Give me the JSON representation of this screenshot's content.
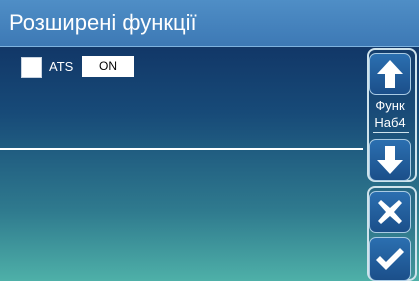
{
  "header": {
    "title": "Розширені функції"
  },
  "settings": [
    {
      "label": "ATS",
      "value": "ON",
      "checked": false
    }
  ],
  "side_panel": {
    "page_label_line1": "Функ",
    "page_label_line2": "Наб4",
    "buttons": {
      "up": "arrow-up-icon",
      "down": "arrow-down-icon",
      "cancel": "close-icon",
      "confirm": "checkmark-icon"
    }
  },
  "colors": {
    "title_bar": "#3d79b5",
    "background_top": "#0e2a5c",
    "background_bottom": "#4eb0a8",
    "button": "#1b4f8a"
  }
}
